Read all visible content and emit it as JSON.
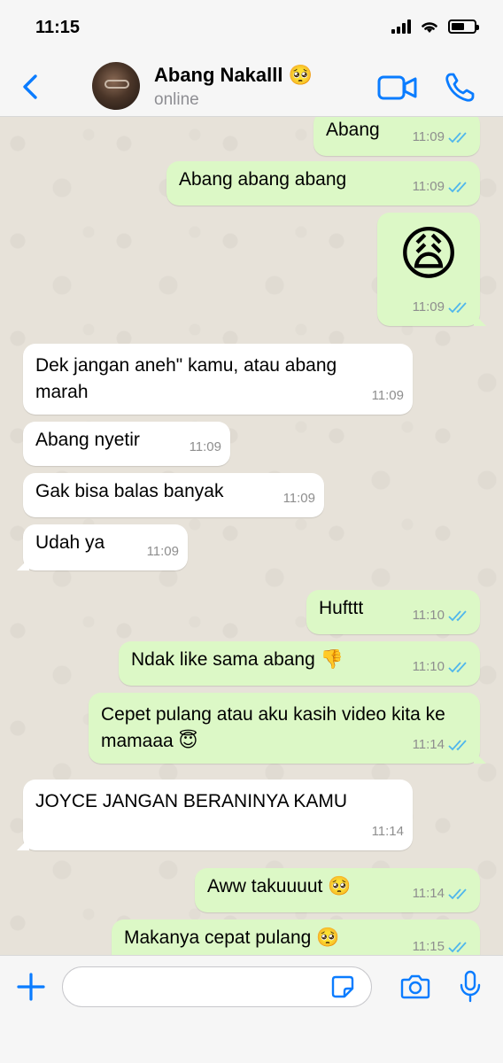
{
  "status_bar": {
    "time": "11:15"
  },
  "header": {
    "contact_name": "Abang Nakalll 🥺",
    "contact_status": "online"
  },
  "colors": {
    "accent": "#0a7cff",
    "outgoing_bubble": "#dcf8c6",
    "incoming_bubble": "#ffffff",
    "chat_background": "#e7e2d9",
    "read_ticks": "#4fb6ec"
  },
  "messages": [
    {
      "direction": "out",
      "text": "Abang",
      "time": "11:09",
      "read": true
    },
    {
      "direction": "out",
      "text": "Abang abang abang",
      "time": "11:09",
      "read": true
    },
    {
      "direction": "out",
      "text": "😩",
      "time": "11:09",
      "read": true
    },
    {
      "direction": "in",
      "text": "Dek jangan aneh\" kamu, atau abang marah",
      "time": "11:09"
    },
    {
      "direction": "in",
      "text": "Abang nyetir",
      "time": "11:09"
    },
    {
      "direction": "in",
      "text": "Gak bisa balas banyak",
      "time": "11:09"
    },
    {
      "direction": "in",
      "text": "Udah ya",
      "time": "11:09"
    },
    {
      "direction": "out",
      "text": "Hufttt",
      "time": "11:10",
      "read": true
    },
    {
      "direction": "out",
      "text": "Ndak like sama abang 👎",
      "time": "11:10",
      "read": true
    },
    {
      "direction": "out",
      "text": "Cepet pulang atau aku kasih video kita ke mamaaa 😇",
      "time": "11:14",
      "read": true
    },
    {
      "direction": "in",
      "text": "JOYCE JANGAN BERANINYA KAMU",
      "time": "11:14"
    },
    {
      "direction": "out",
      "text": "Aww takuuuut 🥺",
      "time": "11:14",
      "read": true
    },
    {
      "direction": "out",
      "text": "Makanya cepat pulang 🥺",
      "time": "11:15",
      "read": true
    }
  ],
  "input": {
    "value": "",
    "placeholder": ""
  },
  "icons": {
    "back": "chevron-left-icon",
    "video": "video-camera-icon",
    "call": "phone-icon",
    "plus": "plus-icon",
    "sticker": "sticker-icon",
    "camera": "camera-icon",
    "mic": "microphone-icon",
    "read_receipt": "double-check-icon"
  }
}
